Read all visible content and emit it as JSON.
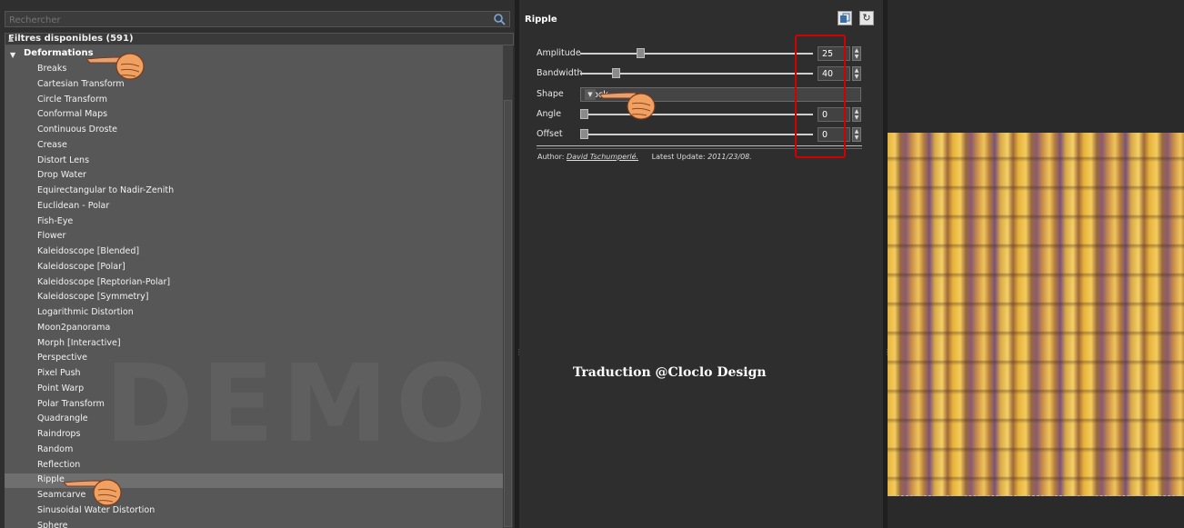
{
  "search": {
    "placeholder": "Rechercher"
  },
  "filters": {
    "header": "Filtres disponibles (591)",
    "category": "Deformations",
    "items": [
      "Breaks",
      "Cartesian Transform",
      "Circle Transform",
      "Conformal Maps",
      "Continuous Droste",
      "Crease",
      "Distort Lens",
      "Drop Water",
      "Equirectangular to Nadir-Zenith",
      "Euclidean - Polar",
      "Fish-Eye",
      "Flower",
      "Kaleidoscope [Blended]",
      "Kaleidoscope [Polar]",
      "Kaleidoscope [Reptorian-Polar]",
      "Kaleidoscope [Symmetry]",
      "Logarithmic Distortion",
      "Moon2panorama",
      "Morph [Interactive]",
      "Perspective",
      "Pixel Push",
      "Point Warp",
      "Polar Transform",
      "Quadrangle",
      "Raindrops",
      "Random",
      "Reflection",
      "Ripple",
      "Seamcarve",
      "Sinusoidal Water Distortion",
      "Sphere"
    ],
    "selected_index": 27
  },
  "filter": {
    "title": "Ripple",
    "params": [
      {
        "label": "Amplitude",
        "value": "25",
        "level": 0.25
      },
      {
        "label": "Bandwidth",
        "value": "40",
        "level": 0.14
      },
      {
        "label": "Shape",
        "value": "Block"
      },
      {
        "label": "Angle",
        "value": "0",
        "level": 0.0
      },
      {
        "label": "Offset",
        "value": "0",
        "level": 0.0
      }
    ],
    "author_label": "Author:",
    "author_name": "David Tschumperlé.",
    "updated_label": "Latest Update:",
    "updated_value": "2011/23/08."
  },
  "watermark": "DEMO VERS",
  "credit": "Traduction @Cloclo Design",
  "colors": {
    "highlight_box": "#d40000"
  }
}
